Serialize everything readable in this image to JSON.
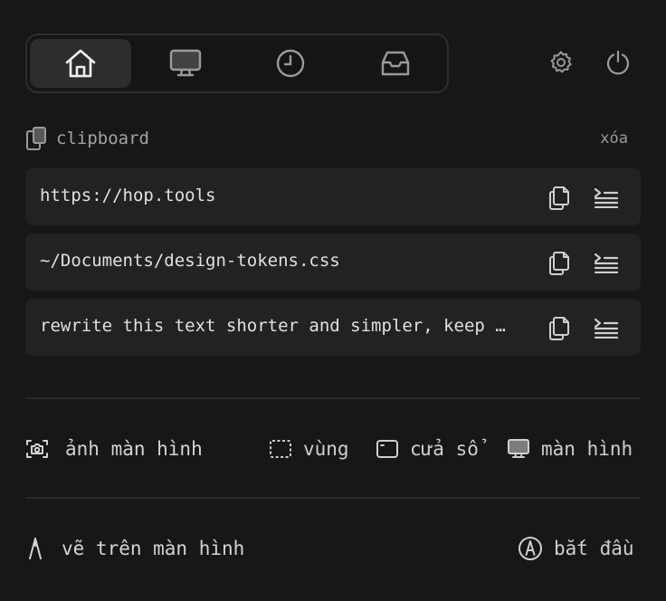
{
  "tabs": [
    {
      "name": "home",
      "icon": "home-icon",
      "active": true
    },
    {
      "name": "display",
      "icon": "monitor-icon",
      "active": false
    },
    {
      "name": "history",
      "icon": "clock-icon",
      "active": false
    },
    {
      "name": "inbox",
      "icon": "inbox-icon",
      "active": false
    }
  ],
  "top_actions": [
    {
      "icon": "gear-icon"
    },
    {
      "icon": "power-icon"
    }
  ],
  "clipboard": {
    "title": "clipboard",
    "clear_label": "xóa",
    "items": [
      {
        "text": "https://hop.tools"
      },
      {
        "text": "~/Documents/design-tokens.css"
      },
      {
        "text": "rewrite this text shorter and simpler, keep the meaning"
      }
    ]
  },
  "screenshot": {
    "label": "ảnh màn hình",
    "options": [
      {
        "label": "vùng",
        "icon": "region-icon"
      },
      {
        "label": "cửa sổ",
        "icon": "window-icon"
      },
      {
        "label": "màn hình",
        "icon": "monitor-icon"
      }
    ]
  },
  "draw": {
    "label": "vẽ trên màn hình",
    "start_label": "bắt đầu"
  },
  "colors": {
    "background": "#171717",
    "row": "#222222",
    "active_tab": "#2d2d2d",
    "text": "#d4d4d4",
    "muted": "#9a9a9a"
  }
}
